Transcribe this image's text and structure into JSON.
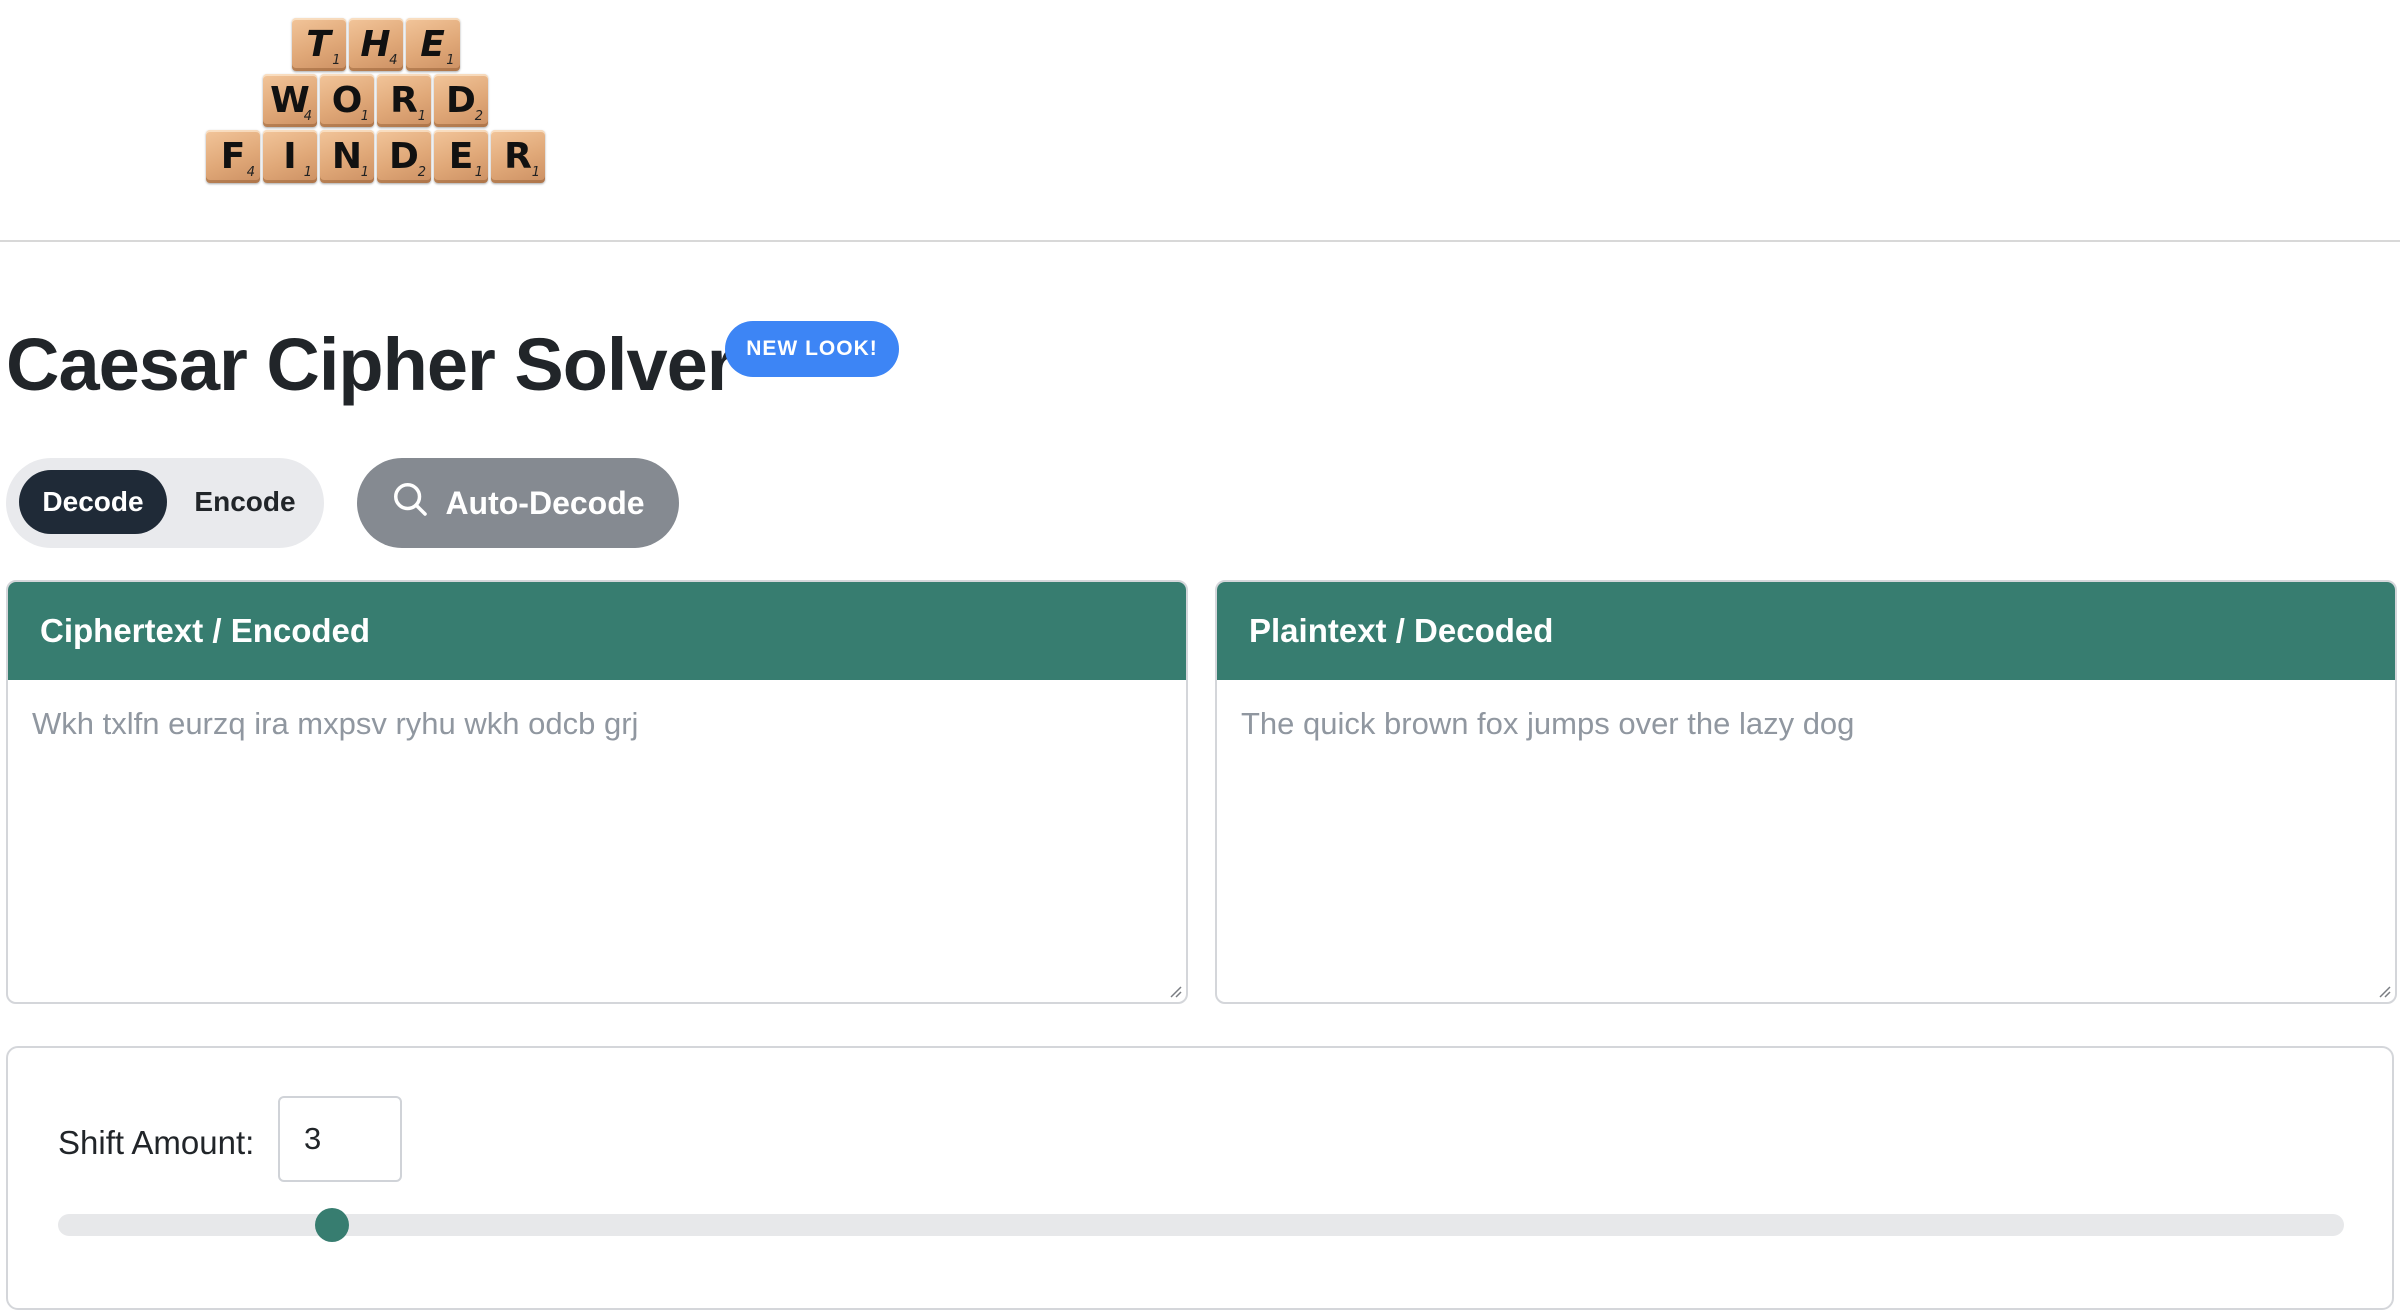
{
  "logo": {
    "rows": [
      [
        {
          "letter": "T",
          "score": "1"
        },
        {
          "letter": "H",
          "score": "4"
        },
        {
          "letter": "E",
          "score": "1"
        }
      ],
      [
        {
          "letter": "W",
          "score": "4"
        },
        {
          "letter": "O",
          "score": "1"
        },
        {
          "letter": "R",
          "score": "1"
        },
        {
          "letter": "D",
          "score": "2"
        }
      ],
      [
        {
          "letter": "F",
          "score": "4"
        },
        {
          "letter": "I",
          "score": "1"
        },
        {
          "letter": "N",
          "score": "1"
        },
        {
          "letter": "D",
          "score": "2"
        },
        {
          "letter": "E",
          "score": "1"
        },
        {
          "letter": "R",
          "score": "1"
        }
      ]
    ]
  },
  "page": {
    "title": "Caesar Cipher Solver",
    "badge": "NEW LOOK!"
  },
  "mode": {
    "decode_label": "Decode",
    "encode_label": "Encode",
    "selected": "Decode"
  },
  "auto_decode": {
    "label": "Auto-Decode",
    "icon": "search-icon"
  },
  "ciphertext": {
    "header": "Ciphertext / Encoded",
    "value": "",
    "placeholder": "Wkh txlfn eurzq ira mxpsv ryhu wkh odcb grj"
  },
  "plaintext": {
    "header": "Plaintext / Decoded",
    "value": "",
    "placeholder": "The quick brown fox jumps over the lazy dog"
  },
  "shift": {
    "label": "Shift Amount:",
    "value": "3",
    "min": 0,
    "max": 25
  },
  "colors": {
    "accent": "#377d70",
    "badge": "#3d85f5",
    "toggle_active": "#1f2a37",
    "auto_decode_bg": "#858a91"
  }
}
